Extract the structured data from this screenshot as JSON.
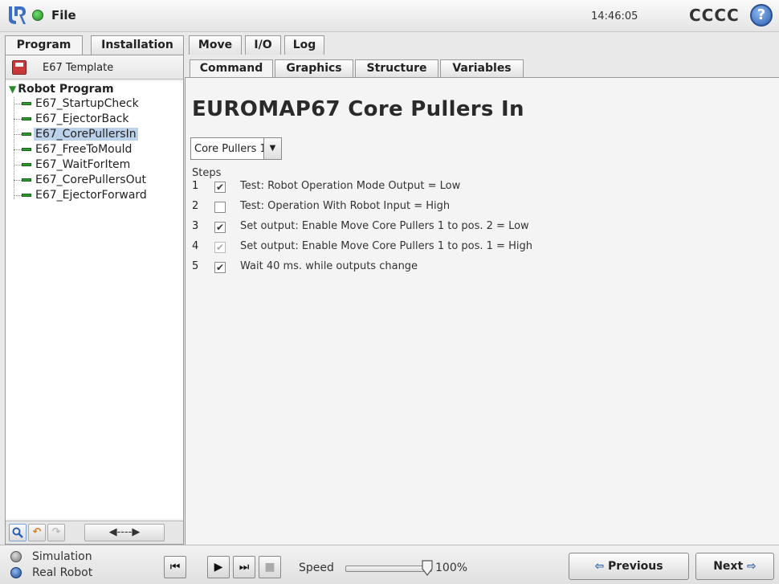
{
  "topbar": {
    "file_label": "File",
    "time": "14:46:05",
    "robot_name": "CCCC",
    "help_glyph": "?"
  },
  "main_tabs": [
    {
      "label": "Program",
      "active": true
    },
    {
      "label": "Installation",
      "active": false
    },
    {
      "label": "Move",
      "active": false
    },
    {
      "label": "I/O",
      "active": false
    },
    {
      "label": "Log",
      "active": false
    }
  ],
  "program": {
    "name": "E67 Template",
    "root": "Robot Program",
    "root_glyph": "▼",
    "items": [
      {
        "label": "E67_StartupCheck"
      },
      {
        "label": "E67_EjectorBack"
      },
      {
        "label": "E67_CorePullersIn",
        "selected": true
      },
      {
        "label": "E67_FreeToMould"
      },
      {
        "label": "E67_WaitForItem"
      },
      {
        "label": "E67_CorePullersOut"
      },
      {
        "label": "E67_EjectorForward"
      }
    ]
  },
  "tools": {
    "search_glyph": "🔍",
    "undo_glyph": "↶",
    "redo_glyph": "↷",
    "expand_glyph": "◀----▶"
  },
  "sub_tabs": [
    {
      "label": "Command",
      "active": true
    },
    {
      "label": "Graphics",
      "active": false
    },
    {
      "label": "Structure",
      "active": false
    },
    {
      "label": "Variables",
      "active": false
    }
  ],
  "command": {
    "title": "EUROMAP67 Core Pullers In",
    "puller_select": "Core Pullers 1",
    "select_glyph": "▼",
    "steps_label": "Steps",
    "steps": [
      {
        "num": "1",
        "checked": true,
        "text": "Test: Robot Operation Mode Output = Low"
      },
      {
        "num": "2",
        "checked": false,
        "text": "Test: Operation With Robot Input = High"
      },
      {
        "num": "3",
        "checked": true,
        "text": "Set output: Enable Move Core Pullers 1 to pos. 2 = Low"
      },
      {
        "num": "4",
        "checked": true,
        "dim": true,
        "text": "Set output: Enable Move Core Pullers 1 to pos. 1 = High"
      },
      {
        "num": "5",
        "checked": true,
        "text": "Wait 40 ms. while outputs change"
      }
    ]
  },
  "bottom": {
    "simulation": "Simulation",
    "real_robot": "Real Robot",
    "speed_label": "Speed",
    "speed_value": "100%",
    "speed_fraction": 1.0,
    "prev_label": "Previous",
    "next_label": "Next",
    "prev_glyph": "⇦",
    "next_glyph": "⇨",
    "btn_rewind": "⏮",
    "btn_play": "▶",
    "btn_step": "⏭",
    "btn_stop": "■"
  },
  "colors": {
    "accent": "#2a5fb0",
    "program_node": "#2f9a2f",
    "selection": "#bcd2ea"
  }
}
